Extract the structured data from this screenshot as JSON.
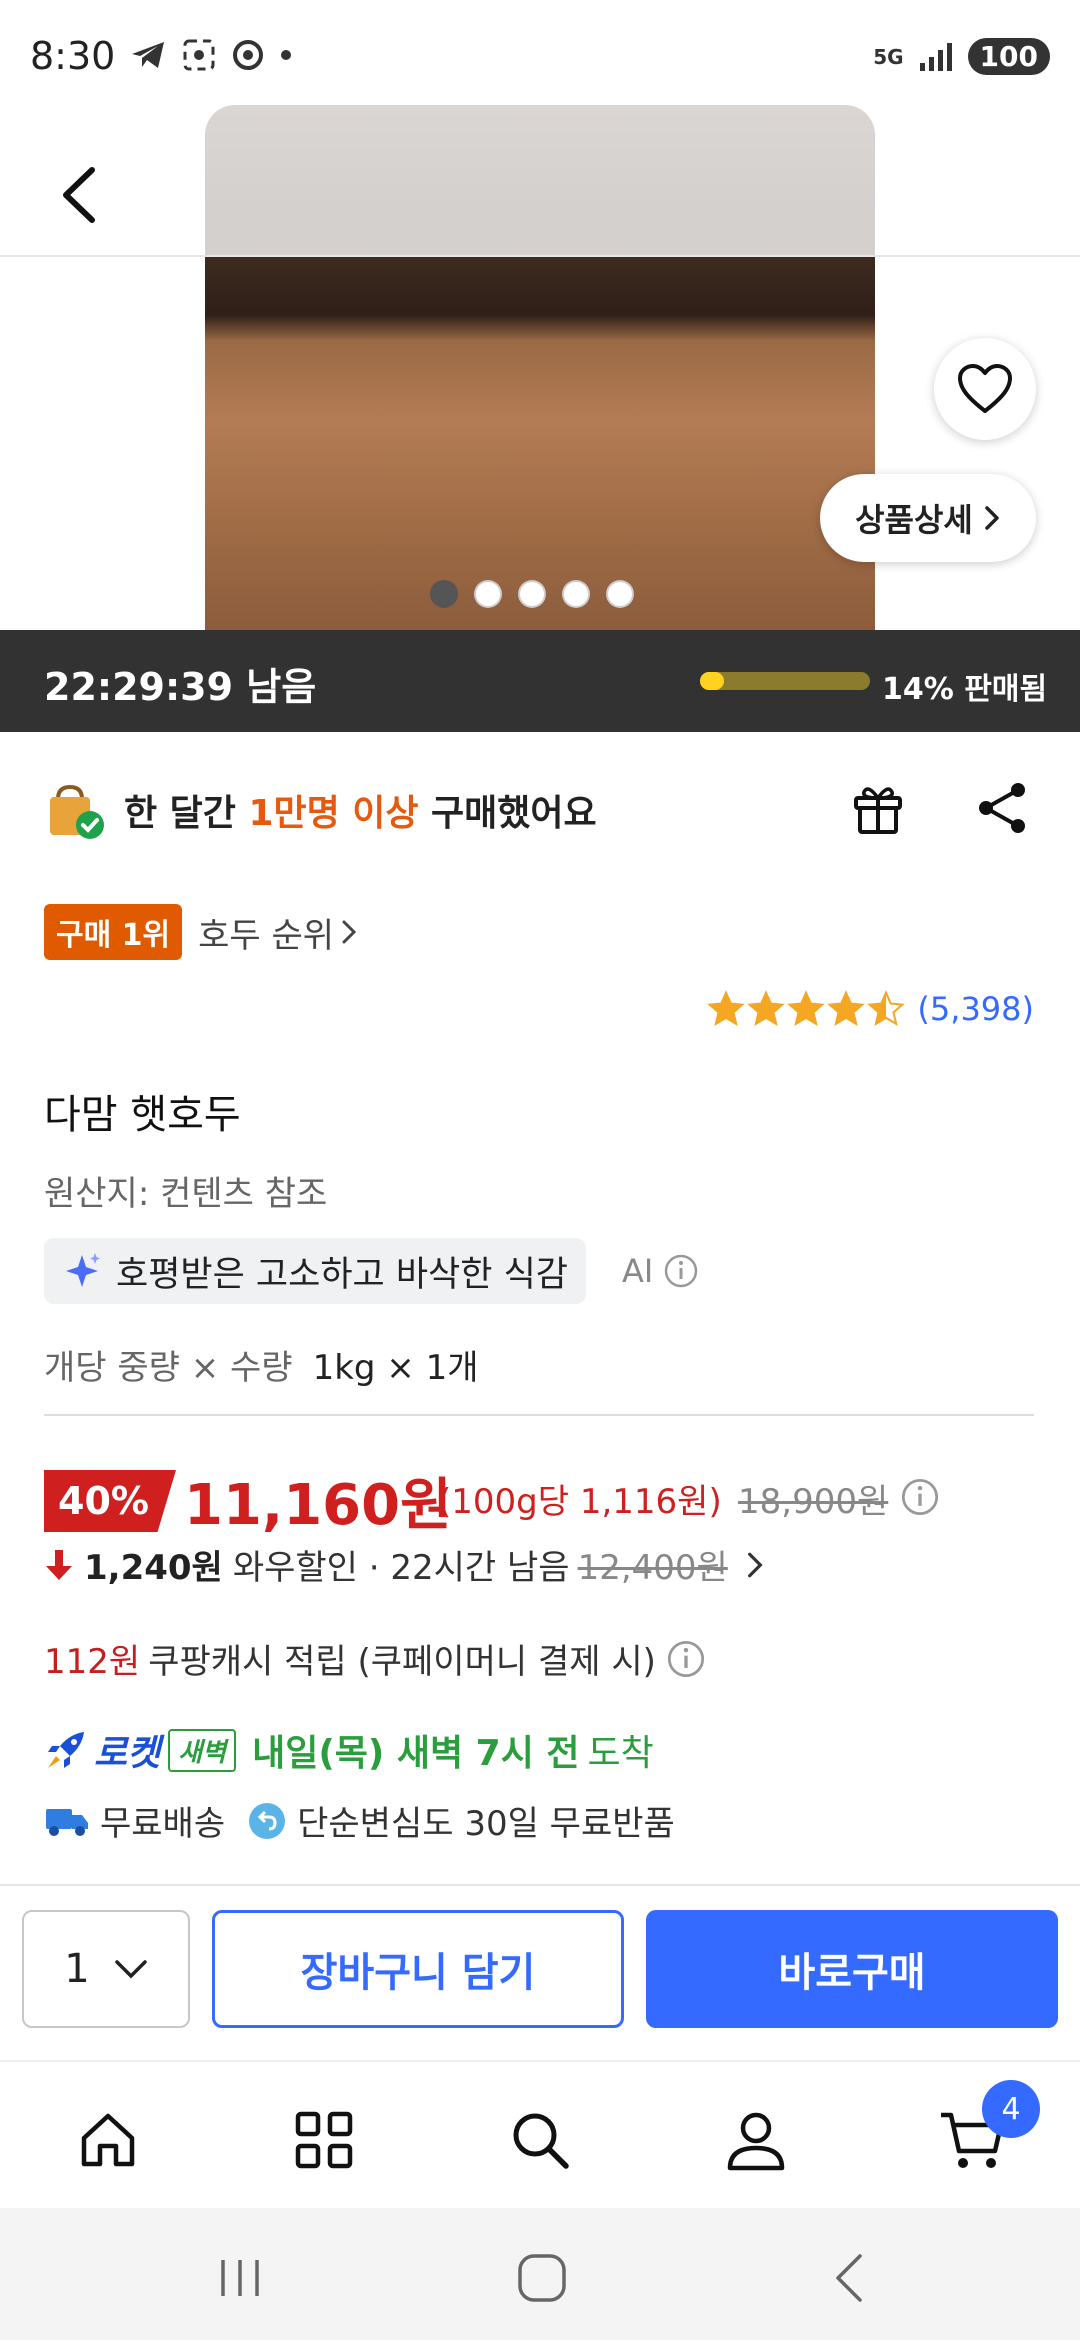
{
  "status_bar": {
    "time": "8:30",
    "network": "5G",
    "battery": "100"
  },
  "hero": {
    "detail_button": "상품상세",
    "dots_total": 5,
    "dots_active_index": 0
  },
  "timer": {
    "remaining": "22:29:39 남음",
    "sold_percent": 14,
    "sold_label": "14% 판매됨"
  },
  "buyers": {
    "prefix": "한 달간 ",
    "highlight": "1만명 이상",
    "suffix": " 구매했어요"
  },
  "rank": {
    "badge": "구매 1위",
    "link": "호두 순위"
  },
  "rating": {
    "stars": 4.5,
    "review_count": "(5,398)"
  },
  "product": {
    "title": "다맘 햇호두",
    "origin": "원산지: 컨텐츠 참조",
    "ai_summary": "호평받은 고소하고 바삭한 식감",
    "ai_label": "AI",
    "option_label": "개당 중량 × 수량",
    "option_value": "1kg × 1개"
  },
  "price": {
    "discount": "40%",
    "sale_price": "11,160원",
    "unit_price": "(100g당 1,116원)",
    "original_price": "18,900원",
    "wow_amount": "1,240원",
    "wow_text": "와우할인 · 22시간 남음",
    "wow_strike": "12,400원"
  },
  "cash": {
    "amount": "112원",
    "text": "쿠팡캐시 적립 (쿠페이머니 결제 시)"
  },
  "delivery": {
    "rocket_label": "로켓",
    "dawn_badge": "새벽",
    "arrival": "내일(목) 새벽 7시 전",
    "arrival_suffix": "도착",
    "free_shipping": "무료배송",
    "free_return": "단순변심도 30일 무료반품"
  },
  "purchase_bar": {
    "quantity": "1",
    "add_to_cart": "장바구니 담기",
    "buy_now": "바로구매"
  },
  "bottom_nav": {
    "cart_count": "4"
  },
  "colors": {
    "accent_blue": "#346aff",
    "sale_red": "#d01f1f",
    "rank_orange": "#e05a00",
    "rocket_green": "#2a9d3c"
  }
}
